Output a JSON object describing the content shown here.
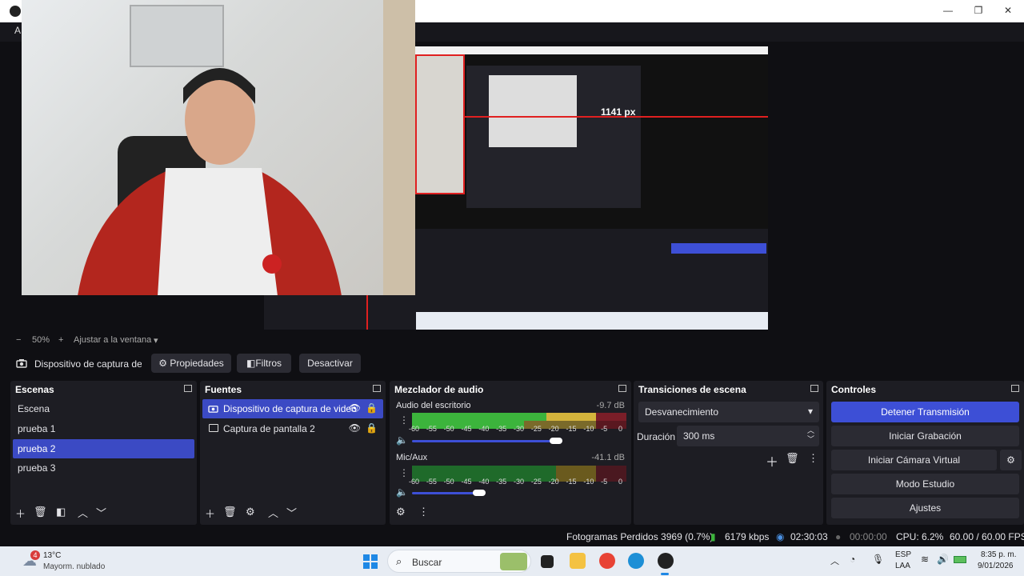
{
  "window": {
    "menu_initial": "A",
    "controls": [
      "—",
      "❐",
      "✕"
    ]
  },
  "preview": {
    "px_label": "1141 px"
  },
  "zoom": {
    "minus": "−",
    "percent": "50%",
    "plus": "+",
    "fit": "Ajustar a la ventana"
  },
  "source_toolbar": {
    "source_name": "Dispositivo de captura de v",
    "properties": "Propiedades",
    "filters": "Filtros",
    "deactivate": "Desactivar"
  },
  "scenes": {
    "title": "Escenas",
    "items": [
      "Escena",
      "prueba 1",
      "prueba 2",
      "prueba 3"
    ],
    "selected": 2
  },
  "sources": {
    "title": "Fuentes",
    "items": [
      "Dispositivo de captura de video",
      "Captura de pantalla 2"
    ],
    "selected": 0
  },
  "mixer": {
    "title": "Mezclador de audio",
    "channels": [
      {
        "name": "Audio del escritorio",
        "db": "-9.7 dB",
        "volume": 0.9
      },
      {
        "name": "Mic/Aux",
        "db": "-41.1 dB",
        "volume": 0.42
      }
    ],
    "ticks": [
      "-60",
      "-55",
      "-50",
      "-45",
      "-40",
      "-35",
      "-30",
      "-25",
      "-20",
      "-15",
      "-10",
      "-5",
      "0"
    ]
  },
  "transitions": {
    "title": "Transiciones de escena",
    "selected": "Desvanecimiento",
    "duration_label": "Duración",
    "duration_value": "300 ms"
  },
  "controls": {
    "title": "Controles",
    "buttons": [
      "Detener Transmisión",
      "Iniciar Grabación",
      "Iniciar Cámara Virtual",
      "Modo Estudio",
      "Ajustes"
    ]
  },
  "status": {
    "dropped": "Fotogramas Perdidos 3969 (0.7%)",
    "bitrate": "6179 kbps",
    "stream_time": "02:30:03",
    "rec_time": "00:00:00",
    "cpu": "CPU: 6.2%",
    "fps": "60.00 / 60.00 FPS"
  },
  "taskbar": {
    "weather_temp": "13°C",
    "weather_desc": "Mayorm. nublado",
    "weather_badge": "4",
    "search": "Buscar",
    "lang1": "ESP",
    "lang2": "LAA",
    "time": "8:35 p. m.",
    "date": "9/01/2026"
  }
}
